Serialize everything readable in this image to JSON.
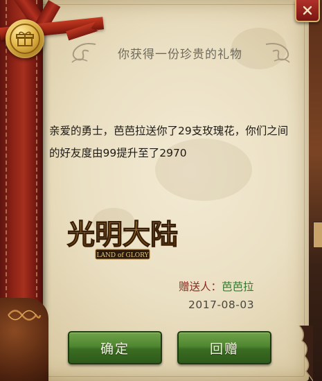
{
  "dialog": {
    "title": "你获得一份珍贵的礼物",
    "message": "亲爱的勇士，芭芭拉送你了29支玫瑰花，你们之间的好友度由99提升至了2970",
    "sender_label": "赠送人：",
    "sender_name": "芭芭拉",
    "date": "2017-08-03",
    "confirm_label": "确定",
    "reply_label": "回赠"
  },
  "logo": {
    "title": "光明大陆",
    "subtitle": "LAND of GLORY"
  },
  "icons": {
    "close": "close-icon",
    "seal": "gift-icon"
  },
  "colors": {
    "parchment": "#eadfc2",
    "button_green": "#4f8630",
    "sender_label": "#8a2a22",
    "sender_name": "#2e7a2a",
    "close_red": "#9a2018",
    "gold": "#e2b548"
  }
}
